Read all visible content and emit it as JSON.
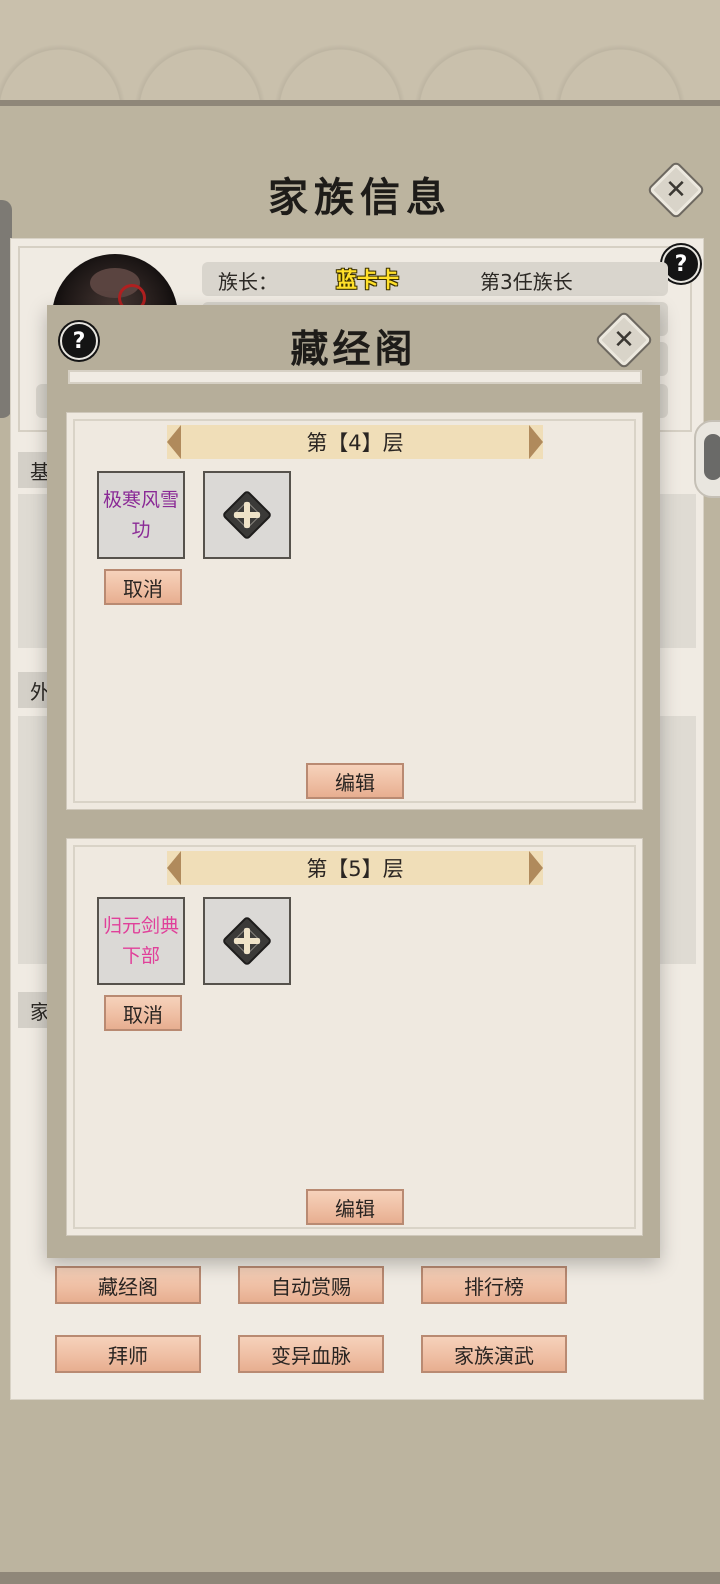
{
  "window": {
    "title": "家族信息"
  },
  "info": {
    "leader_label": "族长：",
    "leader_name": "蓝卡卡",
    "leader_rank": "第3任族长"
  },
  "section_tabs": [
    "基",
    "外",
    "家"
  ],
  "modal": {
    "title": "藏经阁",
    "floors": [
      {
        "label": "第【4】层",
        "skill": "极寒风雪功",
        "skill_color": "#8a2a96",
        "cancel_label": "取消",
        "edit_label": "编辑"
      },
      {
        "label": "第【5】层",
        "skill": "归元剑典下部",
        "skill_color": "#e0409a",
        "cancel_label": "取消",
        "edit_label": "编辑"
      }
    ]
  },
  "buttons": [
    {
      "label": "藏经阁"
    },
    {
      "label": "自动赏赐"
    },
    {
      "label": "排行榜"
    },
    {
      "label": "拜师"
    },
    {
      "label": "变异血脉"
    },
    {
      "label": "家族演武"
    }
  ],
  "icons": {
    "close": "close-icon",
    "help": "help-icon",
    "add": "plus-icon"
  }
}
